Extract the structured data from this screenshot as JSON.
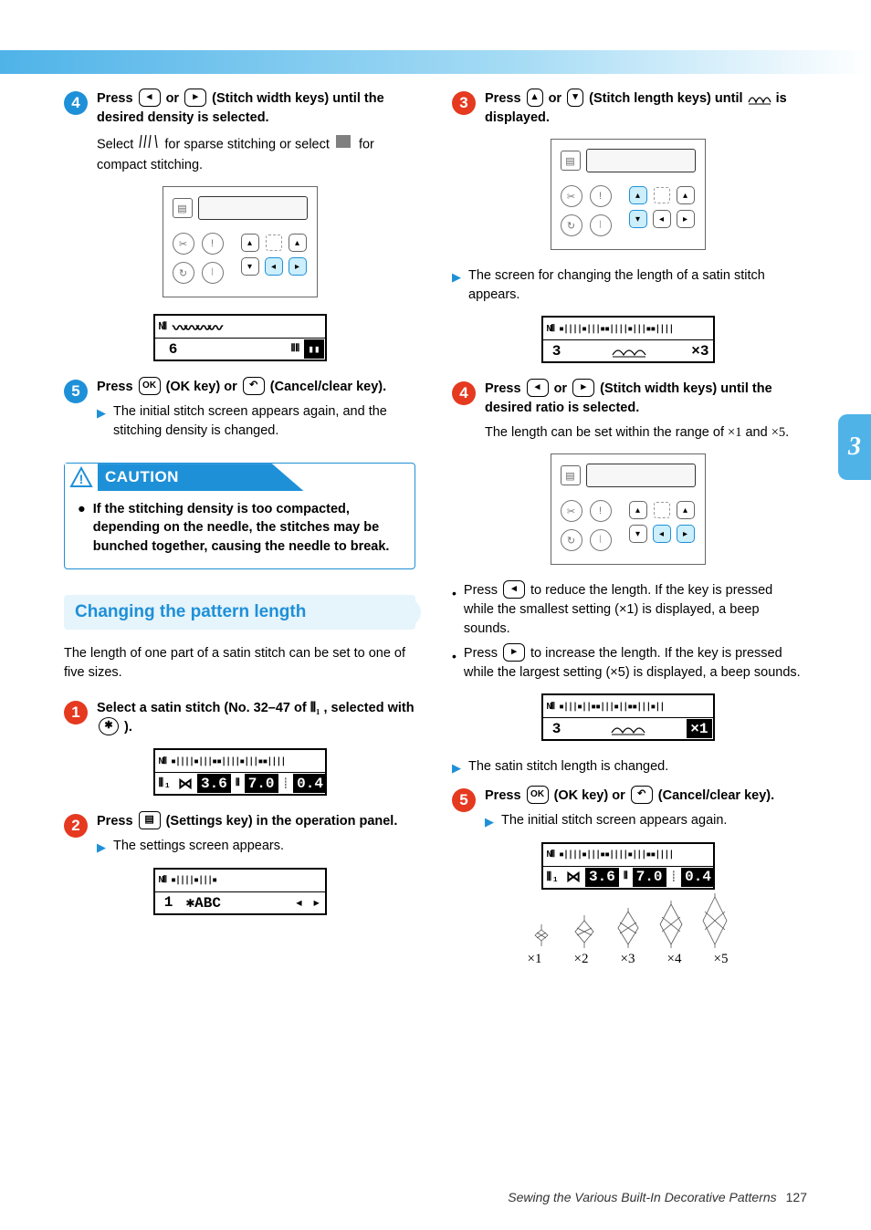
{
  "tab": "3",
  "footer": {
    "title": "Sewing the Various Built-In Decorative Patterns",
    "page": "127"
  },
  "left": {
    "step4": {
      "line1a": "Press ",
      "key_left": "◂",
      "line1b": " or ",
      "key_right": "▸",
      "line1c": " (Stitch width keys) until the desired density is selected.",
      "sub_a": "Select ",
      "sub_b": " for sparse stitching or select ",
      "sub_c": " for compact stitching."
    },
    "lcd_density": {
      "left": "6"
    },
    "step5": {
      "a": "Press ",
      "ok": "OK",
      "b": " (OK key) or ",
      "cancel": "↶",
      "c": " (Cancel/clear key).",
      "result": "The initial stitch screen appears again, and the stitching density is changed."
    },
    "caution": {
      "label": "CAUTION",
      "body": "If the stitching density is too compacted, depending on the needle, the stitches may be bunched together, causing the needle to break."
    },
    "section": "Changing the pattern length",
    "intro": "The length of one part of a satin stitch can be set to one of five sizes.",
    "r_step1": {
      "a": "Select a satin stitch (No. 32–47 of ",
      "b": " , selected with ",
      "c": " )."
    },
    "lcd_main": {
      "row2_a": "⋈",
      "v1": "3.6",
      "v2": "7.0",
      "v3": "0.4"
    },
    "r_step2": {
      "a": "Press ",
      "b": " (Settings key) in the operation panel.",
      "result": "The settings screen appears."
    },
    "lcd_settings": {
      "n": "1",
      "txt": "✱ABC",
      "arr": "◂ ▸"
    }
  },
  "right": {
    "step3": {
      "a": "Press ",
      "up": "▴",
      "b": " or ",
      "down": "▾",
      "c": " (Stitch length keys) until ",
      "d": " is displayed.",
      "result": "The screen for changing the length of a satin stitch appears."
    },
    "lcd_len1": {
      "n": "3",
      "ratio": "×3"
    },
    "step4": {
      "a": "Press ",
      "left": "◂",
      "b": " or ",
      "right": "▸",
      "c": " (Stitch width keys) until the desired ratio is selected.",
      "sub_a": "The length can be set within the range of ",
      "x1": "×1",
      "sub_b": " and ",
      "x5": "×5",
      "sub_c": ".",
      "bul1_a": "Press ",
      "bul1_b": " to reduce the length. If the key is pressed while the smallest setting (×1) is displayed, a beep sounds.",
      "bul2_a": "Press ",
      "bul2_b": " to increase the length. If the key is pressed while the largest setting (×5) is displayed, a beep sounds."
    },
    "lcd_len2": {
      "n": "3",
      "ratio": "×1"
    },
    "result_len": "The satin stitch length is changed.",
    "step5": {
      "a": "Press ",
      "ok": "OK",
      "b": " (OK key) or ",
      "cancel": "↶",
      "c": " (Cancel/clear key).",
      "result": "The initial stitch screen appears again."
    },
    "lcd_final": {
      "row2_a": "⋈",
      "v1": "3.6",
      "v2": "7.0",
      "v3": "0.4"
    },
    "xlabels": [
      "×1",
      "×2",
      "×3",
      "×4",
      "×5"
    ]
  },
  "icons": {
    "sparse": "⦀⦀",
    "dense": "▮",
    "satin_glyph": "⦀₁",
    "mode_circle": "✱",
    "settings_key": "▤",
    "stitch_wave": "⌇"
  }
}
